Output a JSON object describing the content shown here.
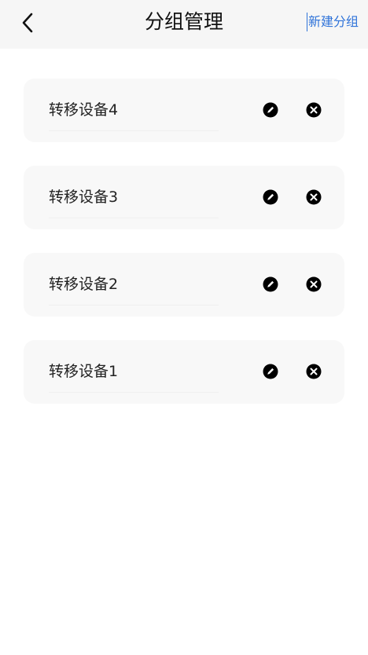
{
  "header": {
    "title": "分组管理",
    "new_group_label": "新建分组",
    "back_icon": "chevron-left-icon"
  },
  "groups": [
    {
      "name": "转移设备4"
    },
    {
      "name": "转移设备3"
    },
    {
      "name": "转移设备2"
    },
    {
      "name": "转移设备1"
    }
  ],
  "icons": {
    "edit": "pencil-icon",
    "delete": "close-circle-icon"
  },
  "colors": {
    "header_bg": "#f6f6f6",
    "accent": "#2f73d9",
    "card_bg": "#f8f8f8",
    "text": "#222222"
  }
}
